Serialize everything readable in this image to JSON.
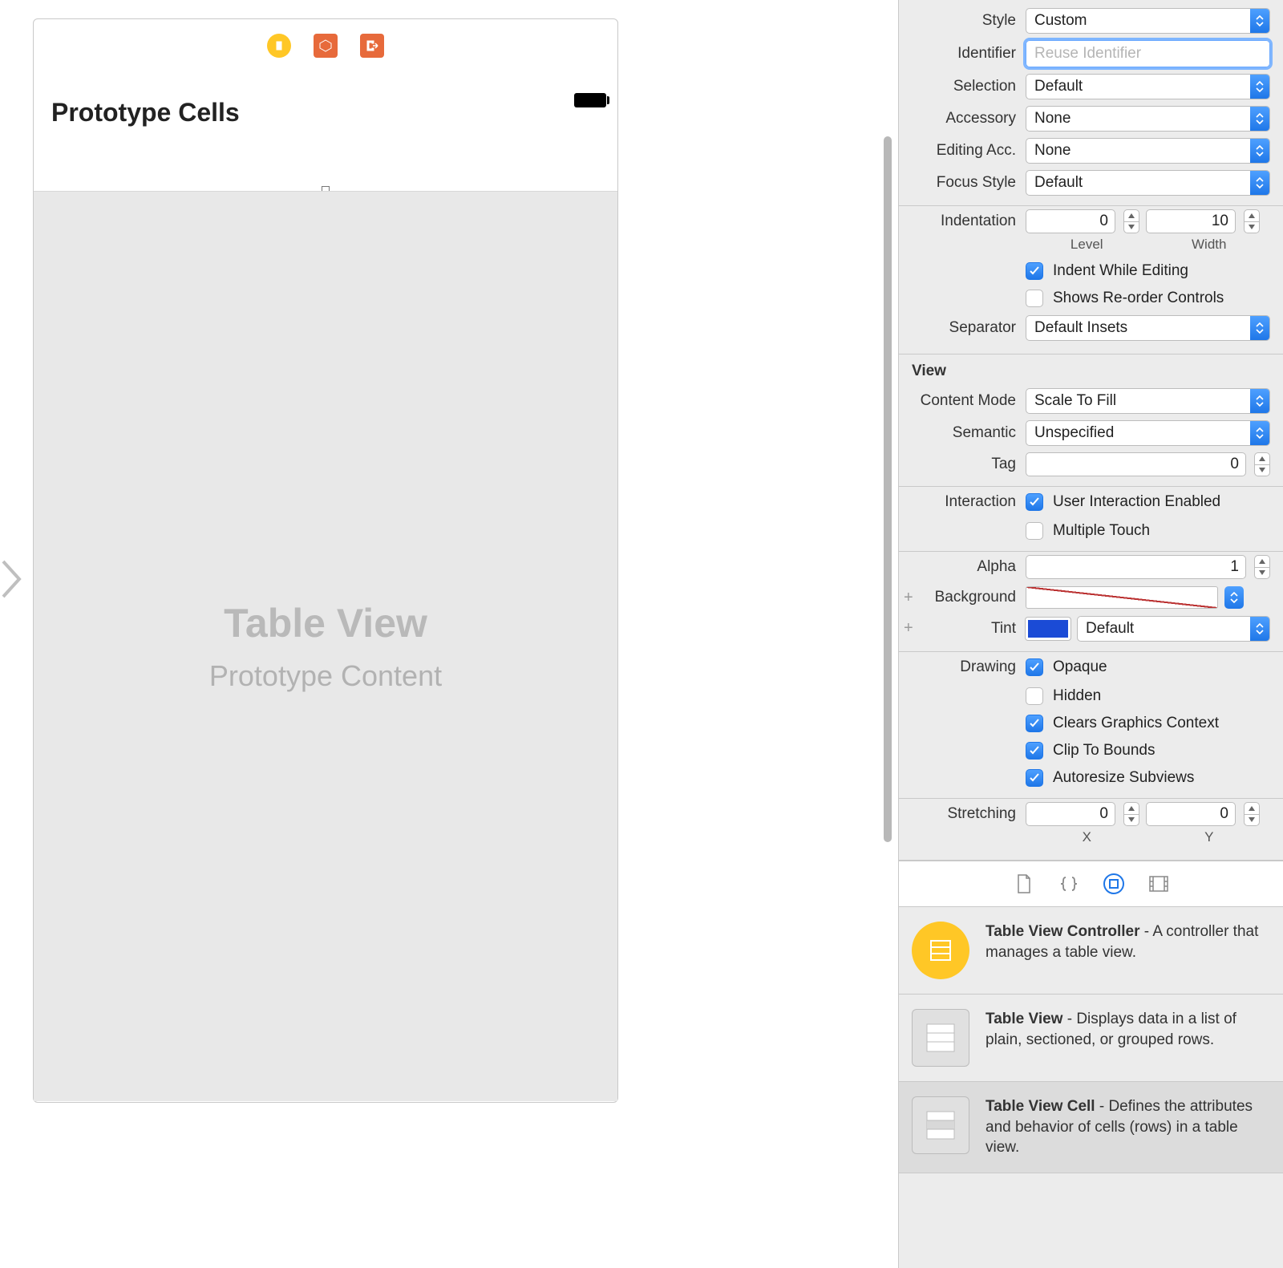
{
  "canvas": {
    "prototype_heading": "Prototype Cells",
    "table_title": "Table View",
    "table_subtitle": "Prototype Content"
  },
  "inspector": {
    "cell": {
      "style_label": "Style",
      "style_value": "Custom",
      "identifier_label": "Identifier",
      "identifier_placeholder": "Reuse Identifier",
      "selection_label": "Selection",
      "selection_value": "Default",
      "accessory_label": "Accessory",
      "accessory_value": "None",
      "editing_acc_label": "Editing Acc.",
      "editing_acc_value": "None",
      "focus_label": "Focus Style",
      "focus_value": "Default",
      "indent_label": "Indentation",
      "indent_level": "0",
      "indent_width": "10",
      "indent_level_sub": "Level",
      "indent_width_sub": "Width",
      "indent_editing": "Indent While Editing",
      "reorder": "Shows Re-order Controls",
      "separator_label": "Separator",
      "separator_value": "Default Insets"
    },
    "view": {
      "title": "View",
      "content_mode_label": "Content Mode",
      "content_mode_value": "Scale To Fill",
      "semantic_label": "Semantic",
      "semantic_value": "Unspecified",
      "tag_label": "Tag",
      "tag_value": "0",
      "interaction_label": "Interaction",
      "user_interaction": "User Interaction Enabled",
      "multi_touch": "Multiple Touch",
      "alpha_label": "Alpha",
      "alpha_value": "1",
      "background_label": "Background",
      "tint_label": "Tint",
      "tint_value": "Default",
      "drawing_label": "Drawing",
      "opaque": "Opaque",
      "hidden": "Hidden",
      "clears_ctx": "Clears Graphics Context",
      "clip": "Clip To Bounds",
      "autoresize": "Autoresize Subviews",
      "stretch_label": "Stretching",
      "stretch_x": "0",
      "stretch_y": "0",
      "stretch_x_sub": "X",
      "stretch_y_sub": "Y"
    }
  },
  "library": {
    "items": [
      {
        "title": "Table View Controller",
        "desc": " - A controller that manages a table view."
      },
      {
        "title": "Table View",
        "desc": " - Displays data in a list of plain, sectioned, or grouped rows."
      },
      {
        "title": "Table View Cell",
        "desc": " - Defines the attributes and behavior of cells (rows) in a table view."
      }
    ]
  }
}
